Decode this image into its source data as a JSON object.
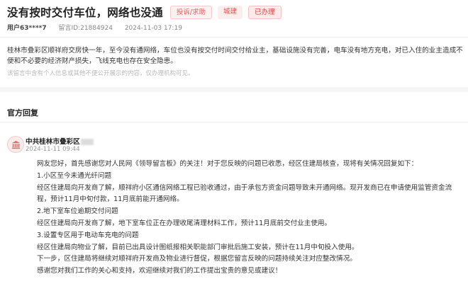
{
  "message": {
    "title": "没有按时交付车位，网络也没通",
    "tags": {
      "type": "投诉/求助",
      "field": "城建",
      "status": "已办理"
    },
    "user": "用户63****7",
    "message_id": "留言ID:21884924",
    "datetime": "2024-11-03 17:19",
    "content": "桂林市叠彩区顺祥府交房快一年，至今没有通网络，车位也没有按交付时间交付给业主，基础设施没有完善，电车没有地方充电，对已入住的业主造成不便和不必要的经济财产损失，飞线充电也存在安全隐患。",
    "notice": "该留言中含有个人信息或其他不便公开展示的内容，仅办理机构可见。"
  },
  "official": {
    "section_title": "官方回复",
    "dept": "中共桂林市叠彩区",
    "date": "2024-11-11 09:44",
    "reply": {
      "greeting": "网友您好，首先感谢您对人民网《领导留言板》的关注！对于您反映的问题已收悉，经区住建局核查，现将有关情况回复如下：",
      "h1": "1.小区至今未通光纤问题",
      "p1": "经区住建局向开发商了解，顺祥府小区通信网络工程已验收通过，由于承包方资金问题导致未开通网络。现开发商已在申请使用监管资金流程，预计11月中旬付款，11月底前能开通网络。",
      "h2": "2.地下室车位逾期交付问题",
      "p2": "经区住建局向开发商了解，地下室车位正在办理收尾清理材料工作，预计11月底前交付业主使用。",
      "h3": "3.设置专区用于电动车充电的问题",
      "p3": "经区住建局向物业了解，目前已出具设计图纸报相关职能部门审批后施工安装，预计在11月中旬投入使用。",
      "p4": "下一步，区住建局将继续对顺祥府开发商及物业进行督促，根据您留言反映的问题持续关注对应整改情况。",
      "closing": "感谢您对我们工作的关心和支持，欢迎继续对我们的工作提出宝贵的意见或建议！"
    }
  },
  "colors": {
    "accent": "#e25555",
    "tag_bg": "#fdeeee",
    "divider": "#ececec"
  },
  "icons": {
    "avatar": "government-emblem-icon"
  }
}
